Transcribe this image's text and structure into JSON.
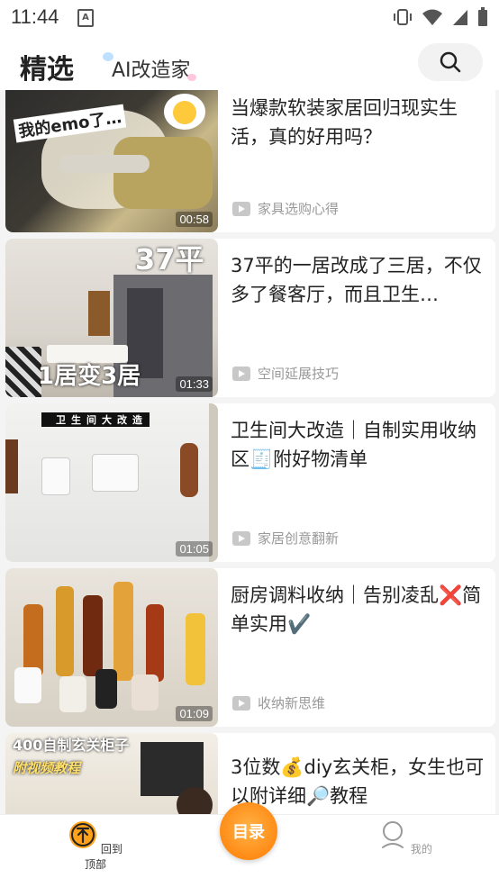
{
  "status_bar": {
    "time": "11:44"
  },
  "header": {
    "tab_main": "精选",
    "tab_ai": "AI改造家"
  },
  "cards": [
    {
      "title": "当爆款软装家居回归现实生活，真的好用吗？",
      "category": "家具选购心得",
      "duration": "00:58",
      "thumb_text": "我的emo了…"
    },
    {
      "title": "37平的一居改成了三居，不仅多了餐客厅，而且卫生…",
      "category": "空间延展技巧",
      "duration": "01:33",
      "thumb_text": "1居变3居",
      "thumb_text2": "37平"
    },
    {
      "title": "卫生间大改造｜自制实用收纳区🧾附好物清单",
      "category": "家居创意翻新",
      "duration": "01:05",
      "thumb_text": "卫生间大改造"
    },
    {
      "title": "厨房调料收纳｜告别凌乱❌简单实用✔️",
      "category": "收纳新思维",
      "duration": "01:09",
      "thumb_text": ""
    },
    {
      "title": "3位数💰diy玄关柜，女生也可以附详细🔎教程",
      "category": "",
      "duration": "",
      "thumb_text": "400自制玄关柜子",
      "thumb_text2": "附视频教程"
    }
  ],
  "bottom_nav": {
    "top_label": "回到顶部",
    "catalog_label": "目录",
    "me_label": "我的"
  },
  "colors": {
    "accent": "#ff8a00",
    "card_bg": "#ffffff",
    "page_bg": "#f4f4f4"
  }
}
